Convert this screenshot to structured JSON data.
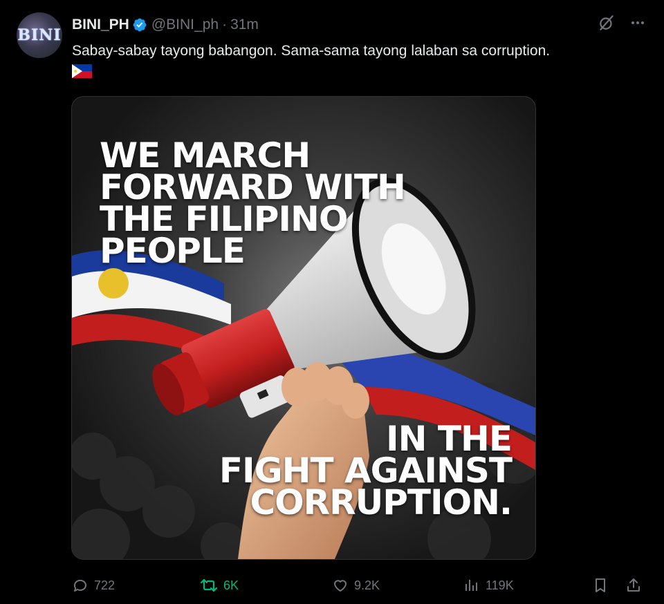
{
  "author": {
    "display_name": "BINI_PH",
    "handle": "@BINI_ph",
    "separator": "·",
    "time": "31m",
    "avatar_text": "BINI",
    "verified": true,
    "verified_color": "#1d9bf0"
  },
  "tweet": {
    "text": "Sabay-sabay tayong babangon. Sama-sama tayong lalaban sa corruption.",
    "emoji": "philippines-flag"
  },
  "media": {
    "headline_top": [
      "WE MARCH",
      "FORWARD WITH",
      "THE FILIPINO",
      "PEOPLE"
    ],
    "headline_bottom": [
      "IN THE",
      "FIGHT AGAINST",
      "CORRUPTION."
    ]
  },
  "top_actions": {
    "grok_icon": "grok-icon",
    "more_icon": "more-icon"
  },
  "stats": {
    "replies": "722",
    "reposts": "6K",
    "likes": "9.2K",
    "views": "119K"
  },
  "colors": {
    "background": "#000000",
    "text": "#e7e9ea",
    "muted": "#71767b",
    "repost_active": "#00ba7c"
  }
}
